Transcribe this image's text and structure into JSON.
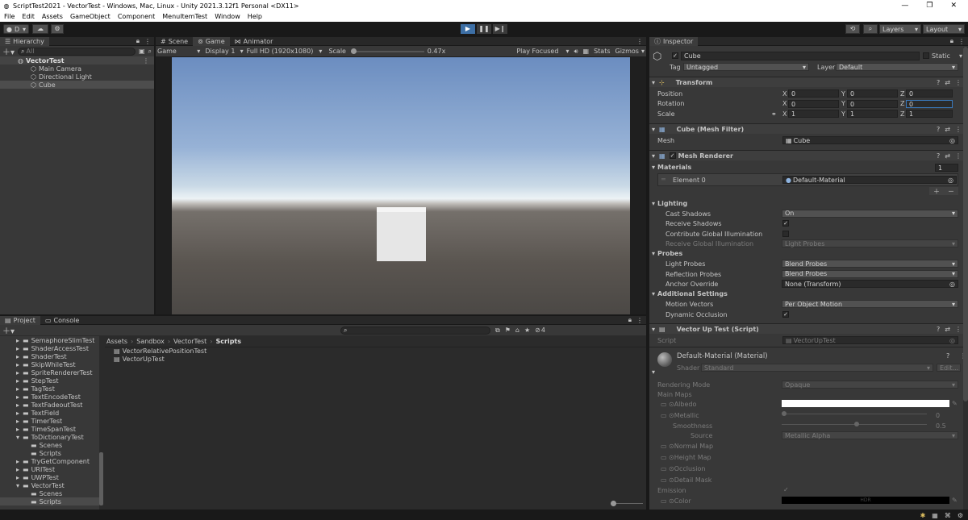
{
  "window": {
    "title": "ScriptTest2021 - VectorTest - Windows, Mac, Linux - Unity 2021.3.12f1 Personal <DX11>"
  },
  "menu": [
    "File",
    "Edit",
    "Assets",
    "GameObject",
    "Component",
    "MenuItemTest",
    "Window",
    "Help"
  ],
  "toolbar": {
    "account": "D",
    "layers": "Layers",
    "layout": "Layout"
  },
  "hierarchy": {
    "tab": "Hierarchy",
    "search_placeholder": "All",
    "scene": "VectorTest",
    "items": [
      "Main Camera",
      "Directional Light",
      "Cube"
    ]
  },
  "game": {
    "tabs": [
      "Scene",
      "Game",
      "Animator"
    ],
    "mode": "Game",
    "display": "Display 1",
    "resolution": "Full HD (1920x1080)",
    "scale_label": "Scale",
    "scale_value": "0.47x",
    "play_mode": "Play Focused",
    "stats": "Stats",
    "gizmos": "Gizmos"
  },
  "project": {
    "tabs": [
      "Project",
      "Console"
    ],
    "tree": [
      {
        "label": "SemaphoreSlimTest",
        "indent": 0,
        "arrow": "▸",
        "folder": true
      },
      {
        "label": "ShaderAccessTest",
        "indent": 0,
        "arrow": "▸",
        "folder": true
      },
      {
        "label": "ShaderTest",
        "indent": 0,
        "arrow": "▸",
        "folder": true
      },
      {
        "label": "SkipWhileTest",
        "indent": 0,
        "arrow": "▸",
        "folder": true
      },
      {
        "label": "SpriteRendererTest",
        "indent": 0,
        "arrow": "▸",
        "folder": true
      },
      {
        "label": "StepTest",
        "indent": 0,
        "arrow": "▸",
        "folder": true
      },
      {
        "label": "TagTest",
        "indent": 0,
        "arrow": "▸",
        "folder": true
      },
      {
        "label": "TextEncodeTest",
        "indent": 0,
        "arrow": "▸",
        "folder": true
      },
      {
        "label": "TextFadeoutTest",
        "indent": 0,
        "arrow": "▸",
        "folder": true
      },
      {
        "label": "TextField",
        "indent": 0,
        "arrow": "▸",
        "folder": true
      },
      {
        "label": "TimerTest",
        "indent": 0,
        "arrow": "▸",
        "folder": true
      },
      {
        "label": "TimeSpanTest",
        "indent": 0,
        "arrow": "▸",
        "folder": true
      },
      {
        "label": "ToDictionaryTest",
        "indent": 0,
        "arrow": "▾",
        "folder": true
      },
      {
        "label": "Scenes",
        "indent": 1,
        "arrow": "",
        "folder": true
      },
      {
        "label": "Scripts",
        "indent": 1,
        "arrow": "",
        "folder": true
      },
      {
        "label": "TryGetComponent",
        "indent": 0,
        "arrow": "▸",
        "folder": true
      },
      {
        "label": "URITest",
        "indent": 0,
        "arrow": "▸",
        "folder": true
      },
      {
        "label": "UWPTest",
        "indent": 0,
        "arrow": "▸",
        "folder": true
      },
      {
        "label": "VectorTest",
        "indent": 0,
        "arrow": "▾",
        "folder": true
      },
      {
        "label": "Scenes",
        "indent": 1,
        "arrow": "",
        "folder": true
      },
      {
        "label": "Scripts",
        "indent": 1,
        "arrow": "",
        "folder": true
      }
    ],
    "breadcrumb": [
      "Assets",
      "Sandbox",
      "VectorTest",
      "Scripts"
    ],
    "files": [
      "VectorRelativePositionTest",
      "VectorUpTest"
    ],
    "hidden_count": "4"
  },
  "inspector": {
    "tab": "Inspector",
    "object_name": "Cube",
    "static_label": "Static",
    "tag_label": "Tag",
    "tag_value": "Untagged",
    "layer_label": "Layer",
    "layer_value": "Default",
    "transform": {
      "title": "Transform",
      "rows": [
        {
          "label": "Position",
          "x": "0",
          "y": "0",
          "z": "0"
        },
        {
          "label": "Rotation",
          "x": "0",
          "y": "0",
          "z": "0"
        },
        {
          "label": "Scale",
          "x": "1",
          "y": "1",
          "z": "1"
        }
      ]
    },
    "mesh_filter": {
      "title": "Cube (Mesh Filter)",
      "mesh_label": "Mesh",
      "mesh_value": "Cube"
    },
    "mesh_renderer": {
      "title": "Mesh Renderer",
      "materials_label": "Materials",
      "materials_count": "1",
      "element_label": "Element 0",
      "element_value": "Default-Material",
      "lighting": "Lighting",
      "lighting_rows": [
        {
          "label": "Cast Shadows",
          "value": "On",
          "type": "dropdown"
        },
        {
          "label": "Receive Shadows",
          "value": "✓",
          "type": "check"
        },
        {
          "label": "Contribute Global Illumination",
          "value": "",
          "type": "check"
        },
        {
          "label": "Receive Global Illumination",
          "value": "Light Probes",
          "type": "disabled"
        }
      ],
      "probes": "Probes",
      "probe_rows": [
        {
          "label": "Light Probes",
          "value": "Blend Probes",
          "type": "dropdown"
        },
        {
          "label": "Reflection Probes",
          "value": "Blend Probes",
          "type": "dropdown"
        },
        {
          "label": "Anchor Override",
          "value": "None (Transform)",
          "type": "object"
        }
      ],
      "additional": "Additional Settings",
      "additional_rows": [
        {
          "label": "Motion Vectors",
          "value": "Per Object Motion",
          "type": "dropdown"
        },
        {
          "label": "Dynamic Occlusion",
          "value": "✓",
          "type": "check"
        }
      ]
    },
    "script": {
      "title": "Vector Up Test (Script)",
      "label": "Script",
      "value": "VectorUpTest"
    },
    "material": {
      "title": "Default-Material (Material)",
      "shader_label": "Shader",
      "shader_value": "Standard",
      "edit": "Edit...",
      "rendering_mode_label": "Rendering Mode",
      "rendering_mode_value": "Opaque",
      "main_maps": "Main Maps",
      "albedo": "Albedo",
      "metallic": "Metallic",
      "metallic_value": "0",
      "smoothness": "Smoothness",
      "smoothness_value": "0.5",
      "source": "Source",
      "source_value": "Metallic Alpha",
      "normal_map": "Normal Map",
      "height_map": "Height Map",
      "occlusion": "Occlusion",
      "detail_mask": "Detail Mask",
      "emission": "Emission",
      "color": "Color",
      "hdr": "HDR"
    }
  }
}
